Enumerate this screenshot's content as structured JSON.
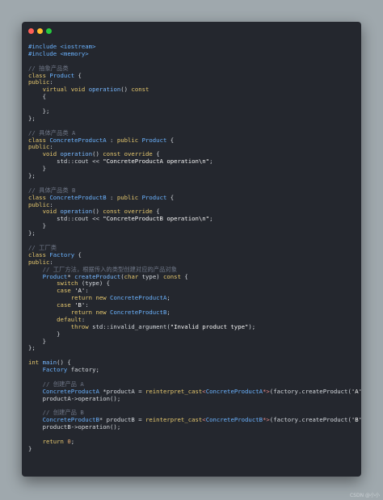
{
  "window_buttons": [
    {
      "name": "close",
      "color": "#ff5f56"
    },
    {
      "name": "minimize",
      "color": "#ffbd2e"
    },
    {
      "name": "maximize",
      "color": "#27c93f"
    }
  ],
  "code_lines": [
    [
      [
        "pp",
        "#include <iostream>"
      ]
    ],
    [
      [
        "pp",
        "#include <memory>"
      ]
    ],
    [],
    [
      [
        "cm",
        "// 抽象产品类"
      ]
    ],
    [
      [
        "kw",
        "class "
      ],
      [
        "type",
        "Product"
      ],
      [
        "p",
        " {"
      ]
    ],
    [
      [
        "kw",
        "public"
      ],
      [
        "p",
        ":"
      ]
    ],
    [
      [
        "p",
        "    "
      ],
      [
        "kw",
        "virtual void "
      ],
      [
        "fn",
        "operation"
      ],
      [
        "p",
        "() "
      ],
      [
        "kw",
        "const"
      ]
    ],
    [
      [
        "p",
        "    {"
      ]
    ],
    [],
    [
      [
        "p",
        "    };"
      ]
    ],
    [
      [
        "p",
        "};"
      ]
    ],
    [],
    [
      [
        "cm",
        "// 具体产品类 A"
      ]
    ],
    [
      [
        "kw",
        "class "
      ],
      [
        "type",
        "ConcreteProductA"
      ],
      [
        "p",
        " : "
      ],
      [
        "kw",
        "public "
      ],
      [
        "type",
        "Product"
      ],
      [
        "p",
        " {"
      ]
    ],
    [
      [
        "kw",
        "public"
      ],
      [
        "p",
        ":"
      ]
    ],
    [
      [
        "p",
        "    "
      ],
      [
        "kw",
        "void "
      ],
      [
        "fn",
        "operation"
      ],
      [
        "p",
        "() "
      ],
      [
        "kw",
        "const override"
      ],
      [
        "p",
        " {"
      ]
    ],
    [
      [
        "p",
        "        std::cout << "
      ],
      [
        "str",
        "\"ConcreteProductA operation\\n\""
      ],
      [
        "p",
        ";"
      ]
    ],
    [
      [
        "p",
        "    }"
      ]
    ],
    [
      [
        "p",
        "};"
      ]
    ],
    [],
    [
      [
        "cm",
        "// 具体产品类 B"
      ]
    ],
    [
      [
        "kw",
        "class "
      ],
      [
        "type",
        "ConcreteProductB"
      ],
      [
        "p",
        " : "
      ],
      [
        "kw",
        "public "
      ],
      [
        "type",
        "Product"
      ],
      [
        "p",
        " {"
      ]
    ],
    [
      [
        "kw",
        "public"
      ],
      [
        "p",
        ":"
      ]
    ],
    [
      [
        "p",
        "    "
      ],
      [
        "kw",
        "void "
      ],
      [
        "fn",
        "operation"
      ],
      [
        "p",
        "() "
      ],
      [
        "kw",
        "const override"
      ],
      [
        "p",
        " {"
      ]
    ],
    [
      [
        "p",
        "        std::cout << "
      ],
      [
        "str",
        "\"ConcreteProductB operation\\n\""
      ],
      [
        "p",
        ";"
      ]
    ],
    [
      [
        "p",
        "    }"
      ]
    ],
    [
      [
        "p",
        "};"
      ]
    ],
    [],
    [
      [
        "cm",
        "// 工厂类"
      ]
    ],
    [
      [
        "kw",
        "class "
      ],
      [
        "type",
        "Factory"
      ],
      [
        "p",
        " {"
      ]
    ],
    [
      [
        "kw",
        "public"
      ],
      [
        "p",
        ":"
      ]
    ],
    [
      [
        "p",
        "    "
      ],
      [
        "cm",
        "// 工厂方法，根据传入的类型创建对应的产品对象"
      ]
    ],
    [
      [
        "p",
        "    "
      ],
      [
        "type",
        "Product"
      ],
      [
        "p",
        "* "
      ],
      [
        "fn",
        "createProduct"
      ],
      [
        "p",
        "("
      ],
      [
        "kw",
        "char "
      ],
      [
        "p",
        "type) "
      ],
      [
        "kw",
        "const"
      ],
      [
        "p",
        " {"
      ]
    ],
    [
      [
        "p",
        "        "
      ],
      [
        "kw",
        "switch"
      ],
      [
        "p",
        " (type) {"
      ]
    ],
    [
      [
        "p",
        "        "
      ],
      [
        "kw",
        "case "
      ],
      [
        "str",
        "'A'"
      ],
      [
        "p",
        ":"
      ]
    ],
    [
      [
        "p",
        "            "
      ],
      [
        "kw",
        "return new "
      ],
      [
        "type",
        "ConcreteProductA"
      ],
      [
        "p",
        ";"
      ]
    ],
    [
      [
        "p",
        "        "
      ],
      [
        "kw",
        "case "
      ],
      [
        "str",
        "'B'"
      ],
      [
        "p",
        ":"
      ]
    ],
    [
      [
        "p",
        "            "
      ],
      [
        "kw",
        "return new "
      ],
      [
        "type",
        "ConcreteProductB"
      ],
      [
        "p",
        ";"
      ]
    ],
    [
      [
        "p",
        "        "
      ],
      [
        "kw",
        "default"
      ],
      [
        "p",
        ":"
      ]
    ],
    [
      [
        "p",
        "            "
      ],
      [
        "kw",
        "throw "
      ],
      [
        "p",
        "std::invalid_argument("
      ],
      [
        "str",
        "\"Invalid product type\""
      ],
      [
        "p",
        ");"
      ]
    ],
    [
      [
        "p",
        "        }"
      ]
    ],
    [
      [
        "p",
        "    }"
      ]
    ],
    [
      [
        "p",
        "};"
      ]
    ],
    [],
    [
      [
        "kw",
        "int "
      ],
      [
        "fn",
        "main"
      ],
      [
        "p",
        "() {"
      ]
    ],
    [
      [
        "p",
        "    "
      ],
      [
        "type",
        "Factory"
      ],
      [
        "p",
        " factory;"
      ]
    ],
    [],
    [
      [
        "p",
        "    "
      ],
      [
        "cm",
        "// 创建产品 A"
      ]
    ],
    [
      [
        "p",
        "    "
      ],
      [
        "type",
        "ConcreteProductA"
      ],
      [
        "p",
        " *productA = "
      ],
      [
        "kw",
        "reinterpret_cast"
      ],
      [
        "op",
        "<"
      ],
      [
        "type",
        "ConcreteProductA"
      ],
      [
        "op",
        "*>"
      ],
      [
        "p",
        "(factory.createProduct("
      ],
      [
        "str",
        "'A'"
      ],
      [
        "p",
        "));"
      ]
    ],
    [
      [
        "p",
        "    productA->operation();"
      ]
    ],
    [],
    [
      [
        "p",
        "    "
      ],
      [
        "cm",
        "// 创建产品 B"
      ]
    ],
    [
      [
        "p",
        "    "
      ],
      [
        "type",
        "ConcreteProductB"
      ],
      [
        "p",
        "* productB = "
      ],
      [
        "kw",
        "reinterpret_cast"
      ],
      [
        "op",
        "<"
      ],
      [
        "type",
        "ConcreteProductB"
      ],
      [
        "op",
        "*>"
      ],
      [
        "p",
        "(factory.createProduct("
      ],
      [
        "str",
        "'B'"
      ],
      [
        "p",
        "));"
      ]
    ],
    [
      [
        "p",
        "    productB->operation();"
      ]
    ],
    [],
    [
      [
        "p",
        "    "
      ],
      [
        "kw",
        "return "
      ],
      [
        "num",
        "0"
      ],
      [
        "p",
        ";"
      ]
    ],
    [
      [
        "p",
        "}"
      ]
    ]
  ],
  "watermark": "CSDN @小小"
}
